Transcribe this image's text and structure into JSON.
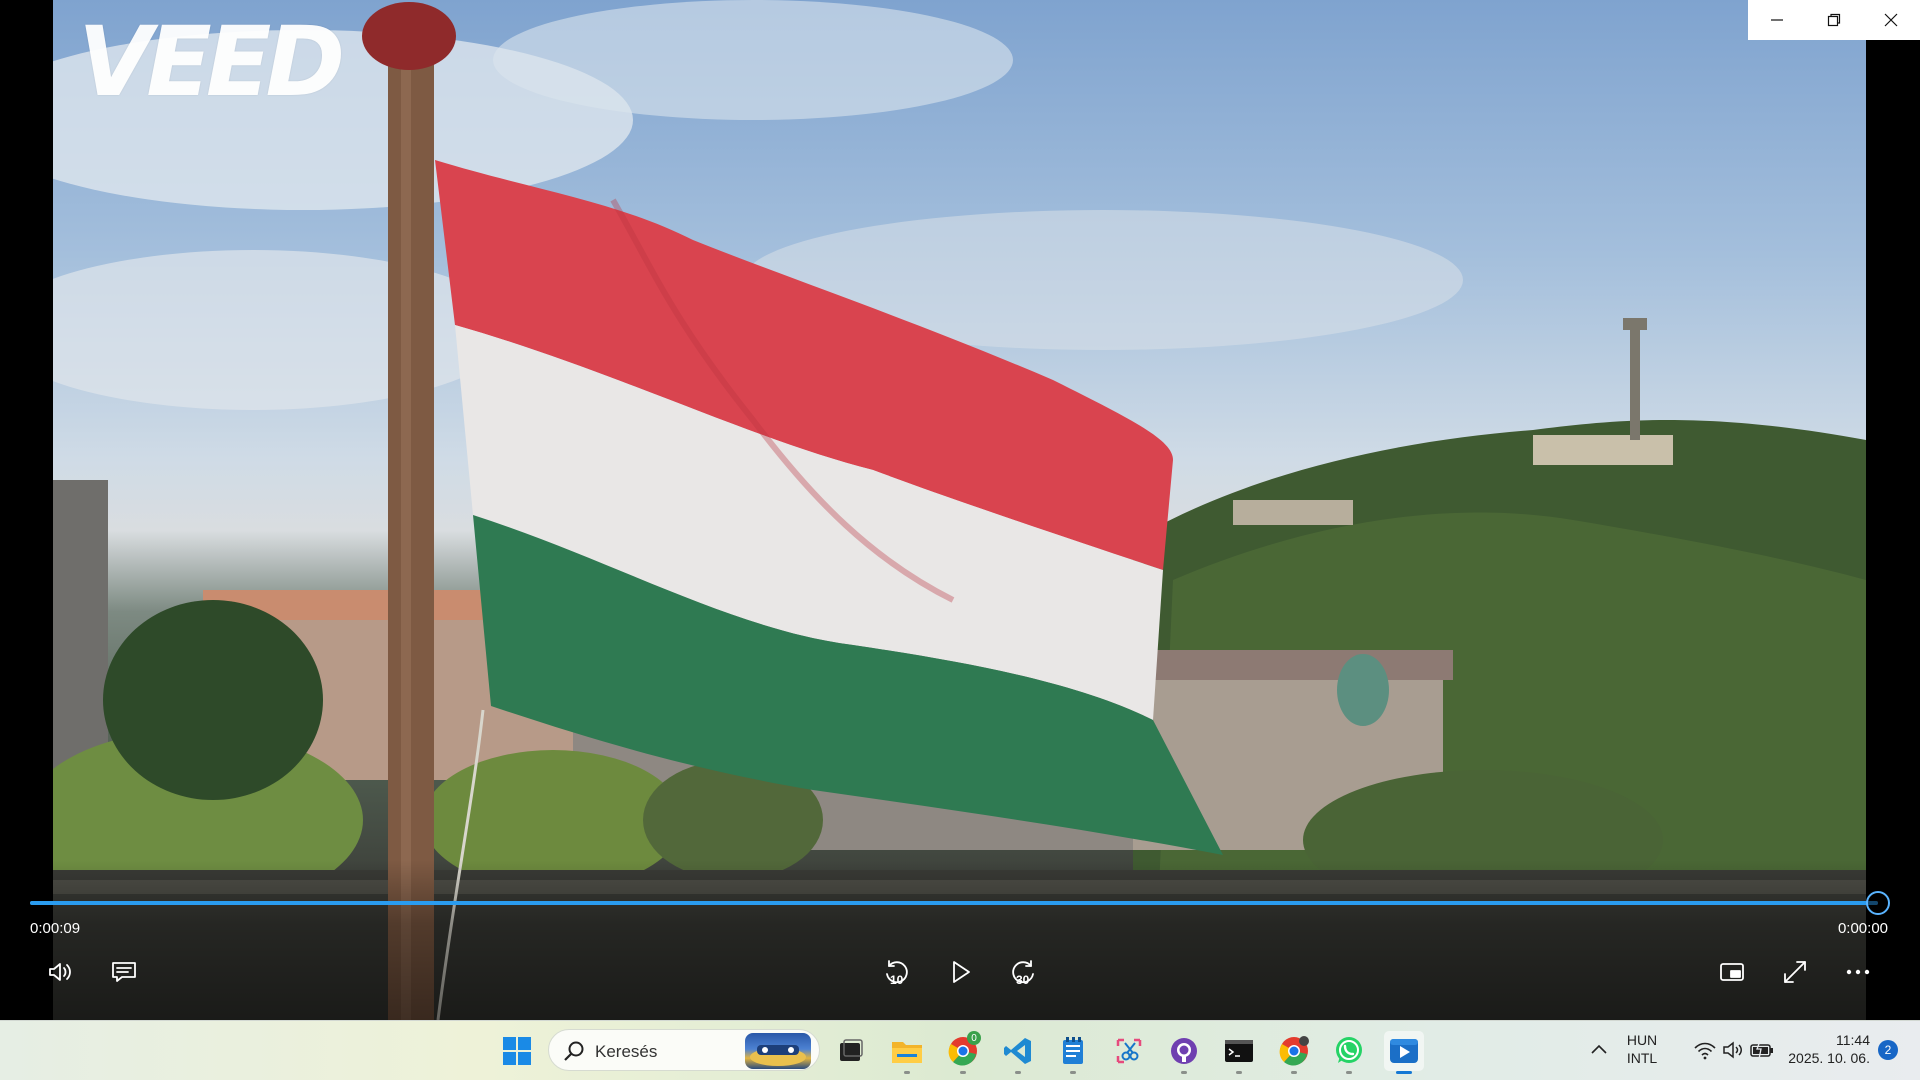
{
  "window": {
    "minimize_icon": "minimize-icon",
    "maximize_icon": "restore-icon",
    "close_icon": "close-icon"
  },
  "video": {
    "watermark": "VEED",
    "content_description_colors": {
      "flag_red": "#d9444f",
      "flag_white": "#e9e7e6",
      "flag_green": "#2f7a52"
    }
  },
  "player": {
    "time_current": "0:00:09",
    "time_total": "0:00:00",
    "progress_fraction": 1.0,
    "accent_color": "#2a9cf0",
    "skip_back_seconds": "10",
    "skip_forward_seconds": "30",
    "controls": {
      "volume": "volume-icon",
      "captions": "captions-icon",
      "skip_back": "skip-back-icon",
      "play": "play-icon",
      "skip_forward": "skip-forward-icon",
      "mini_view": "mini-view-icon",
      "fullscreen": "fullscreen-icon",
      "more": "more-icon"
    }
  },
  "taskbar": {
    "search_placeholder": "Keresés",
    "apps": [
      "start-icon",
      "search",
      "task-view-icon",
      "file-explorer-icon",
      "chrome-icon",
      "vscode-icon",
      "notepad-icon",
      "snipping-tool-icon",
      "github-icon",
      "terminal-icon",
      "chrome-profile-icon",
      "whatsapp-icon",
      "media-player-icon"
    ],
    "chrome_badge": "0",
    "tray": {
      "language_line1": "HUN",
      "language_line2": "INTL",
      "time": "11:44",
      "date": "2025. 10. 06.",
      "notifications": "2"
    }
  }
}
